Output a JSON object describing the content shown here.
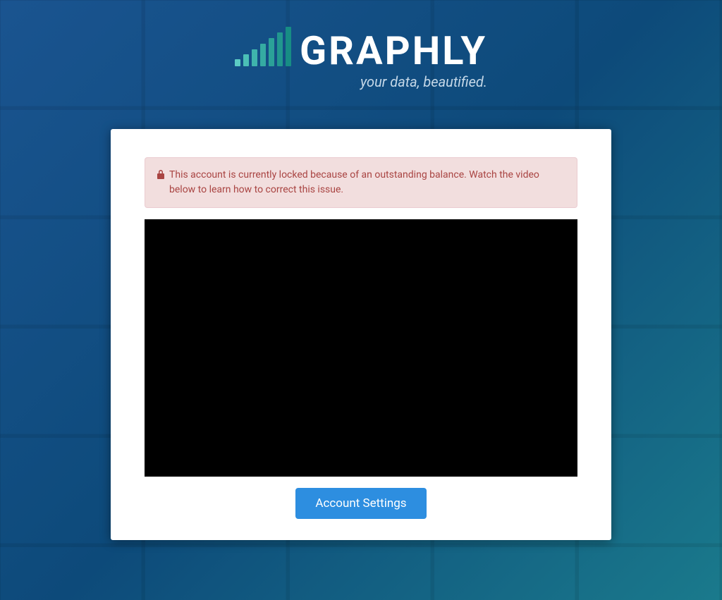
{
  "header": {
    "brand_name": "GRAPHLY",
    "tagline": "your data, beautified."
  },
  "alert": {
    "message": "This account is currently locked because of an outstanding balance. Watch the video below to learn how to correct this issue."
  },
  "actions": {
    "account_settings_label": "Account Settings"
  }
}
